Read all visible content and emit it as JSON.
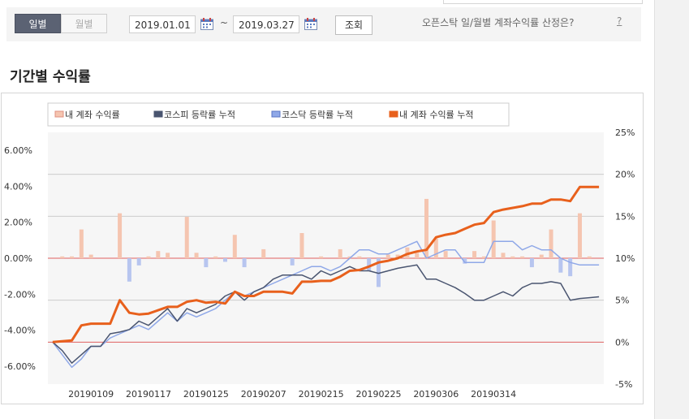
{
  "toolbar": {
    "period_tabs": [
      {
        "label": "일별",
        "active": true
      },
      {
        "label": "월별",
        "active": false
      }
    ],
    "start_date": "2019.01.01",
    "tilde": "~",
    "end_date": "2019.03.27",
    "search_label": "조회",
    "help_text": "오픈스탁 일/월별 계좌수익률 산정은?",
    "help_link": "?"
  },
  "section_title": "기간별 수익률",
  "colors": {
    "daily": "#f5c5b0",
    "kospi": "#4a5570",
    "kosdaq": "#8fa8e8",
    "cumulative": "#e8601c",
    "grid": "#cccccc",
    "zero": "#e06060"
  },
  "chart_data": {
    "type": "bar",
    "legend": [
      "내 계좌 수익률",
      "코스피 등락률 누적",
      "코스닥 등락률 누적",
      "내 계좌 수익률 누적"
    ],
    "legend_position": "top-left",
    "left_axis": {
      "ticks": [
        "6.00%",
        "4.00%",
        "2.00%",
        "0.00%",
        "-2.00%",
        "-4.00%",
        "-6.00%"
      ],
      "range": [
        -7,
        7
      ]
    },
    "right_axis": {
      "ticks": [
        "25%",
        "20%",
        "15%",
        "10%",
        "5%",
        "0%",
        "-5%"
      ],
      "range": [
        -5,
        25
      ]
    },
    "x_ticks": [
      "20190109",
      "20190117",
      "20190125",
      "20190207",
      "20190215",
      "20190225",
      "20190306",
      "20190314"
    ],
    "x_tick_index": [
      4,
      10,
      16,
      22,
      28,
      34,
      40,
      46
    ],
    "days": 58,
    "series": [
      {
        "name": "내 계좌 수익률",
        "type": "bar",
        "axis": "left",
        "values": [
          0,
          0.1,
          0.1,
          1.6,
          0.2,
          0,
          0,
          2.5,
          -1.3,
          -0.4,
          0.1,
          0.4,
          0.3,
          0,
          2.3,
          0.3,
          -0.5,
          0.1,
          -0.2,
          1.3,
          -0.5,
          0,
          0.5,
          0,
          0,
          -0.4,
          1.4,
          0,
          0.1,
          0,
          0.5,
          0.1,
          0.1,
          -0.7,
          -1.6,
          0.2,
          0.2,
          0.6,
          0.3,
          3.3,
          1.1,
          0.4,
          0,
          -0.3,
          0.4,
          0.1,
          2.1,
          0.3,
          0.1,
          0.1,
          -0.5,
          0.2,
          1.6,
          -0.8,
          -1.0,
          2.5,
          0.1,
          0
        ]
      },
      {
        "name": "코스피 등락률 누적",
        "type": "line",
        "axis": "right",
        "values": [
          0,
          -1,
          -2.5,
          -1.5,
          -0.5,
          -0.5,
          1,
          1.2,
          1.5,
          2.5,
          2,
          3,
          4,
          2.5,
          4,
          3.5,
          4,
          4.5,
          5.5,
          6,
          5,
          6,
          6.5,
          7.5,
          8,
          8,
          8,
          7.5,
          8.5,
          8,
          8.5,
          9,
          8.5,
          8.5,
          8.2,
          8.5,
          8.8,
          9,
          9.2,
          7.5,
          7.5,
          7,
          6.5,
          5.8,
          5,
          5,
          5.5,
          6,
          5.5,
          6.5,
          7,
          7,
          7.2,
          7,
          5,
          5.2,
          5.3,
          5.4
        ]
      },
      {
        "name": "코스닥 등락률 누적",
        "type": "line",
        "axis": "right",
        "values": [
          0,
          -1.5,
          -3,
          -2,
          -0.5,
          -0.5,
          0.5,
          1,
          1.5,
          2,
          1.5,
          2.5,
          3.5,
          2.5,
          3.5,
          3,
          3.5,
          4,
          5,
          6,
          5.5,
          6,
          6.5,
          7,
          7.5,
          8,
          8.5,
          9,
          9,
          8.5,
          9,
          10,
          11,
          11,
          10.5,
          10.5,
          11,
          11.5,
          12,
          10,
          10.5,
          11,
          11,
          9.5,
          9.5,
          9.5,
          12,
          12,
          12,
          11,
          11.5,
          11,
          11,
          10,
          9.5,
          9.2,
          9.2,
          9.2
        ]
      },
      {
        "name": "내 계좌 수익률 누적",
        "type": "line",
        "axis": "right",
        "values": [
          0,
          0.1,
          0.2,
          2,
          2.2,
          2.2,
          2.2,
          5,
          3.5,
          3.3,
          3.4,
          3.8,
          4.2,
          4.2,
          4.8,
          5,
          4.7,
          4.8,
          4.6,
          6,
          5.5,
          5.5,
          6,
          6,
          6,
          5.8,
          7.2,
          7.2,
          7.3,
          7.3,
          7.8,
          8.5,
          8.6,
          9,
          9.5,
          9.7,
          10,
          10.5,
          10.8,
          11,
          12.5,
          12.8,
          13,
          13.5,
          14,
          14.2,
          15.5,
          15.8,
          16,
          16.2,
          16.5,
          16.5,
          17,
          17,
          16.8,
          18.5,
          18.5,
          18.5
        ]
      }
    ]
  }
}
